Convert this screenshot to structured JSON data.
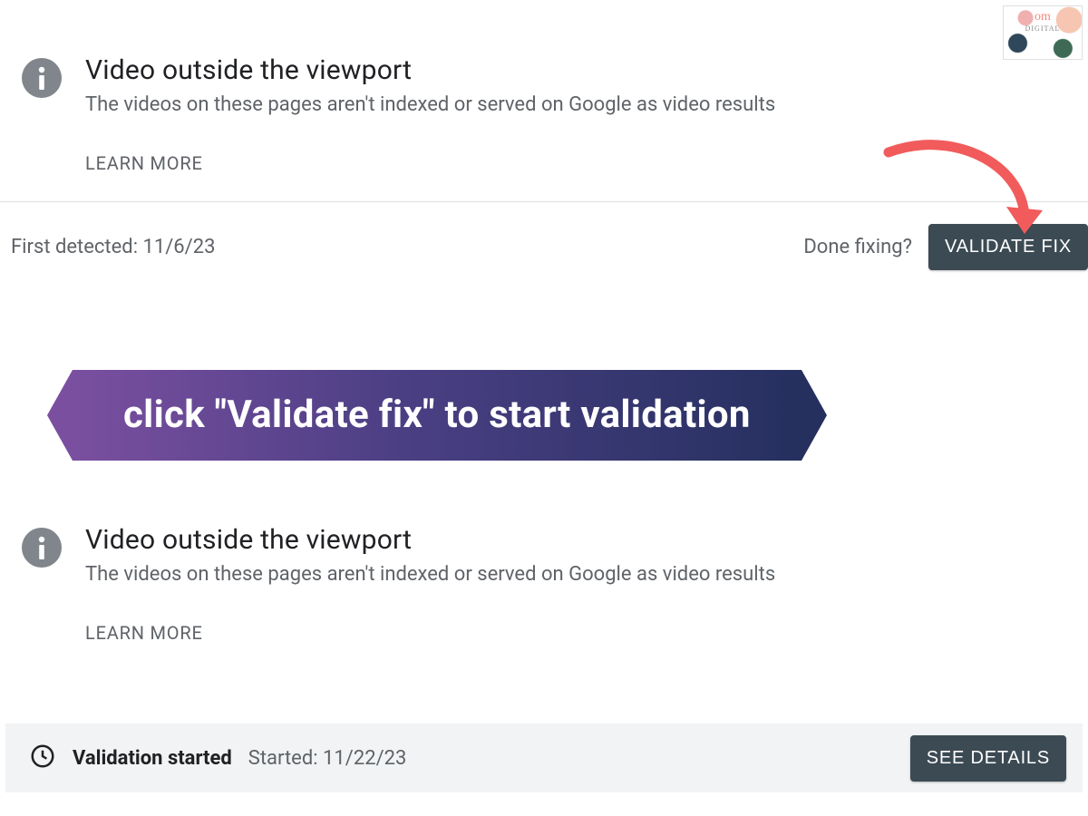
{
  "issue1": {
    "title": "Video outside the viewport",
    "desc": "The videos on these pages aren't indexed or served on Google as video results",
    "learn_more": "LEARN MORE"
  },
  "detect": {
    "first_detected_label": "First detected: 11/6/23",
    "done_fixing": "Done fixing?",
    "validate_btn": "VALIDATE FIX"
  },
  "banner": {
    "text": "click \"Validate fix\" to start validation"
  },
  "issue2": {
    "title": "Video outside the viewport",
    "desc": "The videos on these pages aren't indexed or served on Google as video results",
    "learn_more": "LEARN MORE"
  },
  "status": {
    "label": "Validation started",
    "started": "Started: 11/22/23",
    "see_details": "SEE DETAILS"
  },
  "colors": {
    "button_bg": "#3c4a54",
    "banner_start": "#7a4fa0",
    "banner_end": "#25305f",
    "arrow": "#f15b5b"
  }
}
